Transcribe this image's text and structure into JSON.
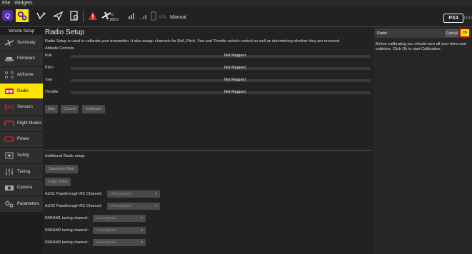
{
  "menubar": {
    "items": [
      "File",
      "Widgets"
    ]
  },
  "toolbar": {
    "battery_value": "0",
    "battery_sub": "100.0",
    "flight_mode": "Manual",
    "px4_logo": "PX4",
    "px4_pro": "pro",
    "gps_label": "N/A"
  },
  "sidebar": {
    "header": "Vehicle Setup",
    "items": [
      {
        "label": "Summary",
        "icon": "plane-icon"
      },
      {
        "label": "Firmware",
        "icon": "firmware-icon"
      },
      {
        "label": "Airframe",
        "icon": "airframe-icon"
      },
      {
        "label": "Radio",
        "icon": "radio-icon"
      },
      {
        "label": "Sensors",
        "icon": "sensors-icon"
      },
      {
        "label": "Flight Modes",
        "icon": "flight-modes-icon"
      },
      {
        "label": "Power",
        "icon": "battery-icon"
      },
      {
        "label": "Safety",
        "icon": "safety-icon"
      },
      {
        "label": "Tuning",
        "icon": "sliders-icon"
      },
      {
        "label": "Camera",
        "icon": "camera-icon"
      },
      {
        "label": "Parameters",
        "icon": "gears-icon"
      }
    ],
    "active_index": 3
  },
  "main": {
    "title": "Radio Setup",
    "description": "Radio Setup is used to calibrate your transmitter. It also assign channels for Roll, Pitch, Yaw and Throttle vehicle control as well as determining whether they are reversed.",
    "attitude_heading": "Attitude Controls",
    "channels": [
      {
        "label": "Roll",
        "value": "Not Mapped"
      },
      {
        "label": "Pitch",
        "value": "Not Mapped"
      },
      {
        "label": "Yaw",
        "value": "Not Mapped"
      },
      {
        "label": "Throttle",
        "value": "Not Mapped"
      }
    ],
    "buttons": {
      "skip": "Skip",
      "cancel": "Cancel",
      "calibrate": "Calibrate"
    },
    "additional_heading": "Additional Radio setup:",
    "spektrum_bind": "Spektrum Bind",
    "copy_trims": "Copy Trims",
    "settings": [
      {
        "label": "AUX1 Passthrough RC Channel:",
        "value": "Unassigned"
      },
      {
        "label": "AUX2 Passthrough RC Channel:",
        "value": "Unassigned"
      },
      {
        "label": "PARAM1 tuning channel:",
        "value": "Unassigned"
      },
      {
        "label": "PARAM2 tuning channel:",
        "value": "Unassigned"
      },
      {
        "label": "PARAM3 tuning channel:",
        "value": "Unassigned"
      }
    ]
  },
  "dialog": {
    "title": "Radio",
    "cancel_label": "Cancel",
    "ok_label": "Ok",
    "message": "Before calibrating you should zero all your trims and subtrims. Click Ok to start Calibration."
  },
  "colors": {
    "accent": "#ffe600",
    "background": "#222222",
    "sidebar_item": "#2e2e2e",
    "highlight_border": "#e00000"
  }
}
